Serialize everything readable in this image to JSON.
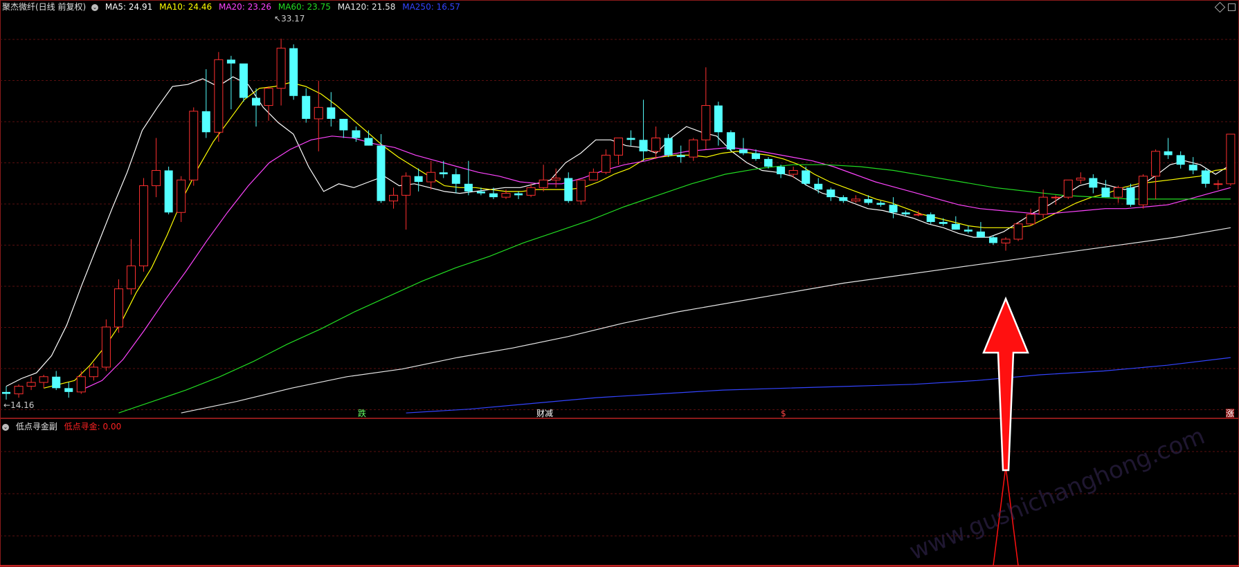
{
  "main_header": {
    "title": "聚杰微纤(日线 前复权)",
    "icon": "chevron-down-icon",
    "ma": [
      {
        "label": "MA5: 24.91",
        "color": "#ffffff"
      },
      {
        "label": "MA10: 24.46",
        "color": "#ffff00"
      },
      {
        "label": "MA20: 23.26",
        "color": "#ff44ff"
      },
      {
        "label": "MA60: 23.75",
        "color": "#22dd22"
      },
      {
        "label": "MA120: 21.58",
        "color": "#e8e8e8"
      },
      {
        "label": "MA250: 16.57",
        "color": "#3344ff"
      }
    ]
  },
  "sub_header": {
    "title": "低点寻金副",
    "icon": "chevron-down-icon",
    "value_label": "低点寻金: 0.00",
    "value_color": "#ff2222"
  },
  "markers": {
    "high_label": "33.17",
    "low_label": "14.16",
    "m1": "跌",
    "m2": "财减",
    "m3": "$",
    "m4": "涨"
  },
  "watermark": "www.gushichanghong.com",
  "colors": {
    "up": "#ff3030",
    "down": "#54ffff",
    "grid": "#5a0f0f",
    "border": "#8b1a1a",
    "arrow": "#ff1010"
  },
  "chart_data": [
    {
      "type": "candlestick",
      "name": "main",
      "ylim": [
        13.5,
        34.5
      ],
      "candles": [
        [
          14.7,
          15.0,
          14.3,
          14.6
        ],
        [
          14.6,
          15.1,
          14.4,
          15.0
        ],
        [
          15.0,
          15.5,
          14.8,
          15.2
        ],
        [
          15.2,
          15.6,
          14.9,
          15.5
        ],
        [
          15.5,
          15.8,
          14.8,
          14.9
        ],
        [
          14.9,
          15.2,
          14.4,
          14.7
        ],
        [
          14.7,
          15.8,
          14.6,
          15.5
        ],
        [
          15.5,
          16.2,
          15.3,
          16.0
        ],
        [
          16.0,
          18.5,
          15.8,
          18.1
        ],
        [
          18.1,
          20.6,
          17.8,
          20.1
        ],
        [
          20.1,
          22.7,
          19.8,
          21.3
        ],
        [
          21.3,
          25.9,
          21.0,
          25.5
        ],
        [
          25.5,
          28.0,
          24.9,
          26.3
        ],
        [
          26.3,
          26.5,
          24.0,
          24.1
        ],
        [
          24.1,
          26.0,
          23.6,
          25.8
        ],
        [
          25.8,
          29.6,
          25.5,
          29.4
        ],
        [
          29.4,
          31.6,
          28.0,
          28.3
        ],
        [
          28.3,
          32.5,
          27.8,
          32.1
        ],
        [
          32.1,
          32.3,
          29.5,
          31.9
        ],
        [
          31.9,
          31.2,
          29.9,
          30.1
        ],
        [
          30.1,
          30.6,
          28.6,
          29.7
        ],
        [
          29.7,
          30.7,
          28.9,
          30.6
        ],
        [
          30.6,
          33.2,
          29.7,
          32.7
        ],
        [
          32.7,
          32.9,
          30.0,
          30.2
        ],
        [
          30.2,
          30.6,
          28.8,
          29.0
        ],
        [
          29.0,
          31.0,
          27.3,
          29.6
        ],
        [
          29.6,
          30.4,
          28.6,
          29.0
        ],
        [
          29.0,
          29.0,
          28.0,
          28.4
        ],
        [
          28.4,
          28.6,
          27.8,
          28.0
        ],
        [
          28.0,
          28.4,
          27.6,
          27.6
        ],
        [
          27.6,
          28.2,
          24.6,
          24.7
        ],
        [
          24.7,
          25.4,
          24.3,
          25.0
        ],
        [
          25.0,
          26.2,
          23.2,
          26.0
        ],
        [
          26.0,
          26.4,
          25.2,
          25.7
        ],
        [
          25.7,
          26.8,
          25.3,
          26.2
        ],
        [
          26.2,
          26.8,
          25.9,
          26.1
        ],
        [
          26.1,
          26.4,
          25.1,
          25.6
        ],
        [
          25.6,
          26.8,
          25.0,
          25.2
        ],
        [
          25.2,
          25.4,
          25.0,
          25.1
        ],
        [
          25.1,
          25.4,
          24.8,
          24.9
        ],
        [
          24.9,
          25.3,
          24.8,
          25.1
        ],
        [
          25.1,
          25.2,
          24.8,
          25.0
        ],
        [
          25.0,
          25.6,
          24.9,
          25.4
        ],
        [
          25.4,
          26.6,
          25.2,
          25.8
        ],
        [
          25.8,
          26.4,
          25.4,
          25.9
        ],
        [
          25.9,
          26.2,
          24.6,
          24.7
        ],
        [
          24.7,
          25.8,
          24.5,
          25.8
        ],
        [
          25.8,
          26.4,
          25.8,
          26.2
        ],
        [
          26.2,
          27.4,
          26.1,
          27.1
        ],
        [
          27.1,
          28.0,
          26.6,
          28.0
        ],
        [
          28.0,
          28.4,
          27.6,
          27.9
        ],
        [
          27.9,
          30.0,
          26.8,
          27.3
        ],
        [
          27.3,
          28.6,
          26.9,
          28.0
        ],
        [
          28.0,
          28.2,
          27.0,
          27.1
        ],
        [
          27.1,
          27.6,
          26.7,
          27.0
        ],
        [
          27.0,
          28.0,
          26.8,
          27.9
        ],
        [
          27.9,
          31.7,
          27.4,
          29.7
        ],
        [
          29.7,
          29.9,
          27.6,
          28.3
        ],
        [
          28.3,
          28.4,
          27.3,
          27.4
        ],
        [
          27.4,
          28.0,
          27.1,
          27.2
        ],
        [
          27.2,
          27.4,
          26.8,
          26.9
        ],
        [
          26.9,
          27.0,
          26.4,
          26.5
        ],
        [
          26.5,
          26.6,
          25.9,
          26.1
        ],
        [
          26.1,
          26.5,
          25.9,
          26.3
        ],
        [
          26.3,
          26.5,
          25.5,
          25.6
        ],
        [
          25.6,
          25.9,
          25.1,
          25.3
        ],
        [
          25.3,
          25.4,
          24.7,
          24.9
        ],
        [
          24.9,
          25.0,
          24.6,
          24.7
        ],
        [
          24.7,
          25.0,
          24.6,
          24.8
        ],
        [
          24.8,
          25.0,
          24.5,
          24.6
        ],
        [
          24.6,
          24.7,
          24.4,
          24.5
        ],
        [
          24.5,
          24.9,
          23.8,
          24.1
        ],
        [
          24.1,
          24.2,
          23.9,
          24.0
        ],
        [
          24.0,
          24.2,
          23.9,
          24.0
        ],
        [
          24.0,
          24.1,
          23.5,
          23.6
        ],
        [
          23.6,
          23.8,
          23.4,
          23.5
        ],
        [
          23.5,
          23.9,
          23.2,
          23.2
        ],
        [
          23.2,
          23.4,
          23.0,
          23.1
        ],
        [
          23.1,
          23.6,
          22.8,
          22.8
        ],
        [
          22.8,
          22.9,
          22.4,
          22.5
        ],
        [
          22.5,
          22.8,
          22.1,
          22.7
        ],
        [
          22.7,
          23.6,
          22.6,
          23.5
        ],
        [
          23.5,
          24.3,
          23.4,
          24.0
        ],
        [
          24.0,
          25.3,
          23.8,
          24.9
        ],
        [
          24.9,
          25.0,
          24.5,
          24.9
        ],
        [
          24.9,
          25.8,
          24.8,
          25.8
        ],
        [
          25.8,
          26.2,
          25.6,
          25.9
        ],
        [
          25.9,
          26.1,
          25.1,
          25.4
        ],
        [
          25.4,
          25.8,
          24.9,
          24.9
        ],
        [
          24.9,
          25.5,
          24.6,
          25.4
        ],
        [
          25.4,
          25.6,
          24.4,
          24.5
        ],
        [
          24.5,
          26.1,
          24.3,
          26.0
        ],
        [
          26.0,
          27.4,
          24.8,
          27.3
        ],
        [
          27.3,
          28.0,
          26.9,
          27.1
        ],
        [
          27.1,
          27.3,
          26.4,
          26.6
        ],
        [
          26.6,
          27.0,
          26.1,
          26.3
        ],
        [
          26.3,
          26.4,
          25.4,
          25.6
        ],
        [
          25.6,
          25.8,
          25.3,
          25.6
        ],
        [
          25.6,
          28.2,
          25.5,
          28.2
        ]
      ],
      "ma_series": [
        {
          "label": "MA5",
          "values": [
            15.0,
            15.4,
            15.7,
            16.6,
            18.2,
            20.3,
            22.3,
            24.3,
            26.2,
            28.4,
            29.6,
            30.7,
            30.8,
            31.1,
            30.7,
            31.2,
            30.8,
            29.6,
            28.8,
            28.2,
            26.5,
            25.2,
            25.6,
            25.4,
            25.7,
            26.0,
            25.5,
            25.6,
            25.4,
            25.2,
            25.1,
            25.2,
            25.3,
            25.4,
            25.4,
            25.6,
            25.8,
            26.7,
            27.2,
            27.9,
            27.9,
            27.6,
            27.5,
            27.2,
            28.0,
            28.6,
            28.3,
            28.1,
            27.3,
            26.7,
            26.3,
            26.2,
            26.0,
            25.5,
            25.1,
            24.9,
            24.6,
            24.3,
            24.2,
            24.0,
            23.8,
            23.5,
            23.3,
            23.0,
            22.8,
            22.8,
            23.1,
            23.6,
            24.1,
            24.5,
            25.0,
            25.5,
            25.7,
            25.5,
            25.3,
            25.5,
            26.0,
            26.6,
            26.8,
            26.6,
            26.1,
            26.6
          ]
        },
        {
          "label": "MA10",
          "values": [
            14.9,
            15.1,
            15.3,
            16.1,
            17.1,
            18.3,
            19.9,
            21.2,
            22.9,
            24.8,
            26.4,
            27.8,
            28.9,
            30.0,
            30.6,
            30.7,
            30.9,
            30.7,
            30.3,
            29.7,
            29.0,
            28.3,
            27.6,
            27.0,
            26.5,
            26.0,
            25.5,
            25.4,
            25.4,
            25.3,
            25.2,
            25.2,
            25.3,
            25.3,
            25.3,
            25.4,
            25.7,
            26.1,
            26.4,
            26.9,
            27.0,
            27.1,
            27.1,
            27.0,
            27.2,
            27.3,
            27.2,
            27.1,
            26.9,
            26.6,
            26.1,
            25.7,
            25.4,
            25.1,
            24.8,
            24.6,
            24.3,
            24.0,
            23.8,
            23.6,
            23.4,
            23.3,
            23.3,
            23.3,
            23.4,
            23.8,
            24.2,
            24.6,
            24.9,
            25.1,
            25.4,
            25.6,
            25.7,
            25.8,
            25.9,
            26.0,
            26.3,
            26.4
          ]
        },
        {
          "label": "MA20",
          "values": [
            14.8,
            15.3,
            16.4,
            17.9,
            19.5,
            21.0,
            22.6,
            24.1,
            25.5,
            26.7,
            27.4,
            27.9,
            28.1,
            28.0,
            27.7,
            27.5,
            27.1,
            26.8,
            26.5,
            26.2,
            26.0,
            25.7,
            25.6,
            25.6,
            25.9,
            26.3,
            26.6,
            26.8,
            27.1,
            27.3,
            27.4,
            27.5,
            27.4,
            27.2,
            27.0,
            26.8,
            26.5,
            26.1,
            25.7,
            25.4,
            25.1,
            24.8,
            24.5,
            24.3,
            24.2,
            24.1,
            24.0,
            24.1,
            24.2,
            24.3,
            24.3,
            24.4,
            24.5,
            24.8,
            25.1,
            25.4
          ]
        },
        {
          "label": "MA60",
          "values": [
            13.6,
            14.2,
            14.8,
            15.5,
            16.3,
            17.2,
            18.0,
            18.9,
            19.7,
            20.5,
            21.2,
            21.8,
            22.5,
            23.1,
            23.7,
            24.4,
            25.0,
            25.6,
            26.1,
            26.4,
            26.6,
            26.6,
            26.5,
            26.3,
            26.0,
            25.7,
            25.4,
            25.2,
            25.0,
            24.9,
            24.8,
            24.8,
            24.8,
            24.8
          ]
        },
        {
          "label": "MA120",
          "values": [
            13.6,
            14.2,
            14.9,
            15.5,
            15.9,
            16.5,
            17.0,
            17.6,
            18.3,
            18.9,
            19.4,
            19.9,
            20.4,
            20.8,
            21.2,
            21.6,
            22.0,
            22.4,
            22.8,
            23.3
          ]
        },
        {
          "label": "MA250",
          "values": [
            13.6,
            13.8,
            14.1,
            14.4,
            14.6,
            14.8,
            14.9,
            15.0,
            15.1,
            15.3,
            15.6,
            15.8,
            16.1,
            16.5
          ]
        }
      ]
    },
    {
      "type": "line",
      "name": "低点寻金",
      "ylim": [
        0,
        1
      ],
      "spike_bar_index": 80,
      "values": [
        0,
        1,
        0
      ]
    }
  ]
}
